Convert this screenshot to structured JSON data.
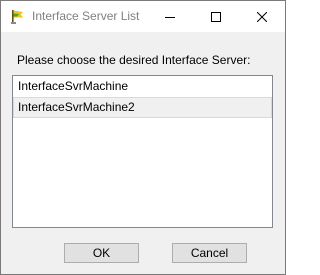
{
  "window": {
    "title": "Interface Server List",
    "icon": "flag-app-icon"
  },
  "title_buttons": {
    "minimize": "minimize-icon",
    "maximize": "maximize-icon",
    "close": "close-icon"
  },
  "prompt": "Please choose the desired Interface Server:",
  "servers": [
    {
      "label": "InterfaceSvrMachine",
      "selected": false
    },
    {
      "label": "InterfaceSvrMachine2",
      "selected": true
    }
  ],
  "buttons": {
    "ok_label": "OK",
    "cancel_label": "Cancel"
  },
  "colors": {
    "title_text": "#808080",
    "dialog_bg": "#f0f0f0",
    "selected_item_bg": "#f0f0f0",
    "button_bg": "#e1e1e1",
    "button_border": "#adadad"
  }
}
